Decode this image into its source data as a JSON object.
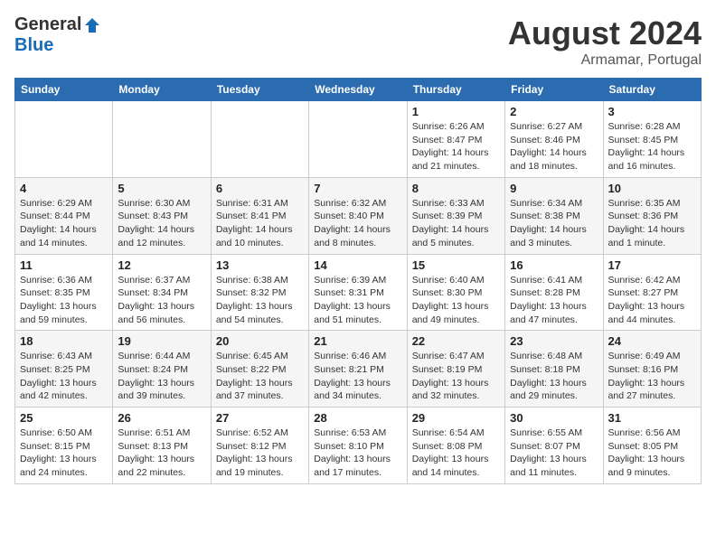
{
  "header": {
    "logo_general": "General",
    "logo_blue": "Blue",
    "month_year": "August 2024",
    "location": "Armamar, Portugal"
  },
  "days_of_week": [
    "Sunday",
    "Monday",
    "Tuesday",
    "Wednesday",
    "Thursday",
    "Friday",
    "Saturday"
  ],
  "weeks": [
    [
      {
        "day": "",
        "info": ""
      },
      {
        "day": "",
        "info": ""
      },
      {
        "day": "",
        "info": ""
      },
      {
        "day": "",
        "info": ""
      },
      {
        "day": "1",
        "info": "Sunrise: 6:26 AM\nSunset: 8:47 PM\nDaylight: 14 hours and 21 minutes."
      },
      {
        "day": "2",
        "info": "Sunrise: 6:27 AM\nSunset: 8:46 PM\nDaylight: 14 hours and 18 minutes."
      },
      {
        "day": "3",
        "info": "Sunrise: 6:28 AM\nSunset: 8:45 PM\nDaylight: 14 hours and 16 minutes."
      }
    ],
    [
      {
        "day": "4",
        "info": "Sunrise: 6:29 AM\nSunset: 8:44 PM\nDaylight: 14 hours and 14 minutes."
      },
      {
        "day": "5",
        "info": "Sunrise: 6:30 AM\nSunset: 8:43 PM\nDaylight: 14 hours and 12 minutes."
      },
      {
        "day": "6",
        "info": "Sunrise: 6:31 AM\nSunset: 8:41 PM\nDaylight: 14 hours and 10 minutes."
      },
      {
        "day": "7",
        "info": "Sunrise: 6:32 AM\nSunset: 8:40 PM\nDaylight: 14 hours and 8 minutes."
      },
      {
        "day": "8",
        "info": "Sunrise: 6:33 AM\nSunset: 8:39 PM\nDaylight: 14 hours and 5 minutes."
      },
      {
        "day": "9",
        "info": "Sunrise: 6:34 AM\nSunset: 8:38 PM\nDaylight: 14 hours and 3 minutes."
      },
      {
        "day": "10",
        "info": "Sunrise: 6:35 AM\nSunset: 8:36 PM\nDaylight: 14 hours and 1 minute."
      }
    ],
    [
      {
        "day": "11",
        "info": "Sunrise: 6:36 AM\nSunset: 8:35 PM\nDaylight: 13 hours and 59 minutes."
      },
      {
        "day": "12",
        "info": "Sunrise: 6:37 AM\nSunset: 8:34 PM\nDaylight: 13 hours and 56 minutes."
      },
      {
        "day": "13",
        "info": "Sunrise: 6:38 AM\nSunset: 8:32 PM\nDaylight: 13 hours and 54 minutes."
      },
      {
        "day": "14",
        "info": "Sunrise: 6:39 AM\nSunset: 8:31 PM\nDaylight: 13 hours and 51 minutes."
      },
      {
        "day": "15",
        "info": "Sunrise: 6:40 AM\nSunset: 8:30 PM\nDaylight: 13 hours and 49 minutes."
      },
      {
        "day": "16",
        "info": "Sunrise: 6:41 AM\nSunset: 8:28 PM\nDaylight: 13 hours and 47 minutes."
      },
      {
        "day": "17",
        "info": "Sunrise: 6:42 AM\nSunset: 8:27 PM\nDaylight: 13 hours and 44 minutes."
      }
    ],
    [
      {
        "day": "18",
        "info": "Sunrise: 6:43 AM\nSunset: 8:25 PM\nDaylight: 13 hours and 42 minutes."
      },
      {
        "day": "19",
        "info": "Sunrise: 6:44 AM\nSunset: 8:24 PM\nDaylight: 13 hours and 39 minutes."
      },
      {
        "day": "20",
        "info": "Sunrise: 6:45 AM\nSunset: 8:22 PM\nDaylight: 13 hours and 37 minutes."
      },
      {
        "day": "21",
        "info": "Sunrise: 6:46 AM\nSunset: 8:21 PM\nDaylight: 13 hours and 34 minutes."
      },
      {
        "day": "22",
        "info": "Sunrise: 6:47 AM\nSunset: 8:19 PM\nDaylight: 13 hours and 32 minutes."
      },
      {
        "day": "23",
        "info": "Sunrise: 6:48 AM\nSunset: 8:18 PM\nDaylight: 13 hours and 29 minutes."
      },
      {
        "day": "24",
        "info": "Sunrise: 6:49 AM\nSunset: 8:16 PM\nDaylight: 13 hours and 27 minutes."
      }
    ],
    [
      {
        "day": "25",
        "info": "Sunrise: 6:50 AM\nSunset: 8:15 PM\nDaylight: 13 hours and 24 minutes."
      },
      {
        "day": "26",
        "info": "Sunrise: 6:51 AM\nSunset: 8:13 PM\nDaylight: 13 hours and 22 minutes."
      },
      {
        "day": "27",
        "info": "Sunrise: 6:52 AM\nSunset: 8:12 PM\nDaylight: 13 hours and 19 minutes."
      },
      {
        "day": "28",
        "info": "Sunrise: 6:53 AM\nSunset: 8:10 PM\nDaylight: 13 hours and 17 minutes."
      },
      {
        "day": "29",
        "info": "Sunrise: 6:54 AM\nSunset: 8:08 PM\nDaylight: 13 hours and 14 minutes."
      },
      {
        "day": "30",
        "info": "Sunrise: 6:55 AM\nSunset: 8:07 PM\nDaylight: 13 hours and 11 minutes."
      },
      {
        "day": "31",
        "info": "Sunrise: 6:56 AM\nSunset: 8:05 PM\nDaylight: 13 hours and 9 minutes."
      }
    ]
  ]
}
